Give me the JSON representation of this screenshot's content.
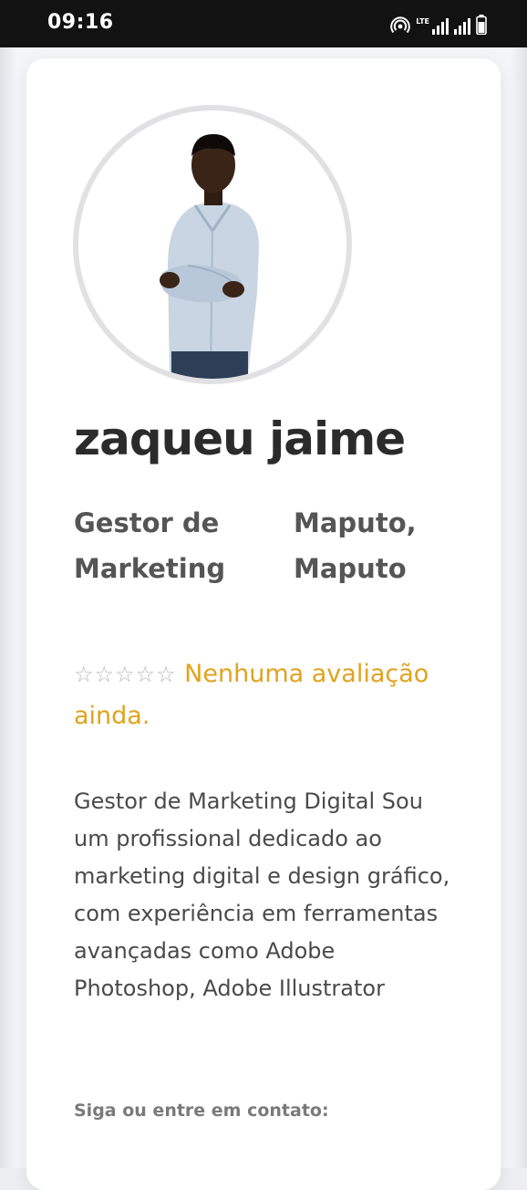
{
  "status_bar": {
    "time": "09:16",
    "network_label": "LTE",
    "icons": [
      "hotspot-icon",
      "signal-icon",
      "signal-icon",
      "battery-icon"
    ]
  },
  "profile": {
    "avatar": "profile-photo",
    "name": "zaqueu jaime",
    "role": "Gestor de Marketing",
    "location": "Maputo, Maputo",
    "rating": {
      "stars": "☆☆☆☆☆",
      "value": 0,
      "max": 5,
      "text": "Nenhuma avaliação ainda."
    },
    "bio": "Gestor de Marketing Digital Sou um profissional dedicado ao marketing digital e design gráfico, com experiência em ferramentas avançadas como Adobe Photoshop, Adobe Illustrator",
    "contact_label": "Siga ou entre em contato:"
  },
  "colors": {
    "rating_text": "#e0a31e",
    "star_empty": "#b8b8b8",
    "name_text": "#2b2b2b",
    "status_bar": "#121212"
  }
}
